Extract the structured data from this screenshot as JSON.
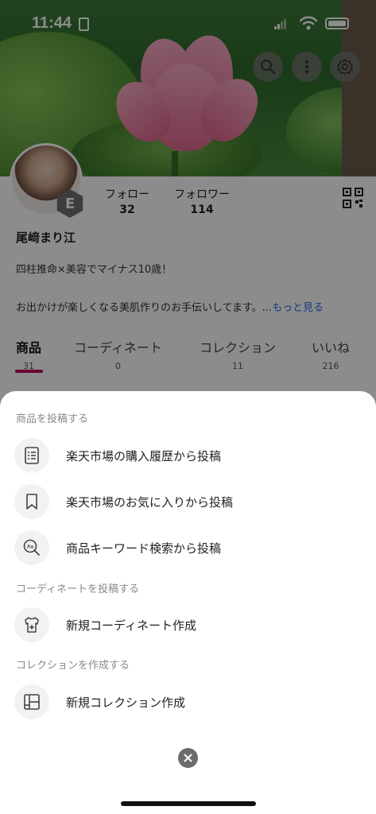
{
  "status_bar": {
    "time": "11:44"
  },
  "header_icons": [
    "search-icon",
    "more-vertical-icon",
    "gear-icon"
  ],
  "profile": {
    "badge_letter": "E",
    "follow_label": "フォロー",
    "follow_count": "32",
    "follower_label": "フォロワー",
    "follower_count": "114",
    "name": "尾﨑まり江",
    "bio_line1": "四柱推命×美容でマイナス10歳！",
    "bio_line2": "お出かけが楽しくなる美肌作りのお手伝いしてます。...",
    "more_link": "もっと見る"
  },
  "tabs": [
    {
      "label": "商品",
      "count": "31",
      "active": true
    },
    {
      "label": "コーディネート",
      "count": "0",
      "active": false
    },
    {
      "label": "コレクション",
      "count": "11",
      "active": false
    },
    {
      "label": "いいね",
      "count": "216",
      "active": false
    }
  ],
  "sheet": {
    "sections": [
      {
        "title": "商品を投稿する",
        "items": [
          {
            "label": "楽天市場の購入履歴から投稿",
            "icon": "receipt-list-icon"
          },
          {
            "label": "楽天市場のお気に入りから投稿",
            "icon": "bookmark-icon"
          },
          {
            "label": "商品キーワード検索から投稿",
            "icon": "keyword-search-icon"
          }
        ]
      },
      {
        "title": "コーディネートを投稿する",
        "items": [
          {
            "label": "新規コーディネート作成",
            "icon": "shirt-add-icon"
          }
        ]
      },
      {
        "title": "コレクションを作成する",
        "items": [
          {
            "label": "新規コレクション作成",
            "icon": "collection-grid-icon"
          }
        ]
      }
    ],
    "close_icon": "close-icon"
  },
  "colors": {
    "accent": "#bf0058",
    "link": "#2a6edb",
    "overlay": "rgba(0,0,0,0.45)"
  }
}
